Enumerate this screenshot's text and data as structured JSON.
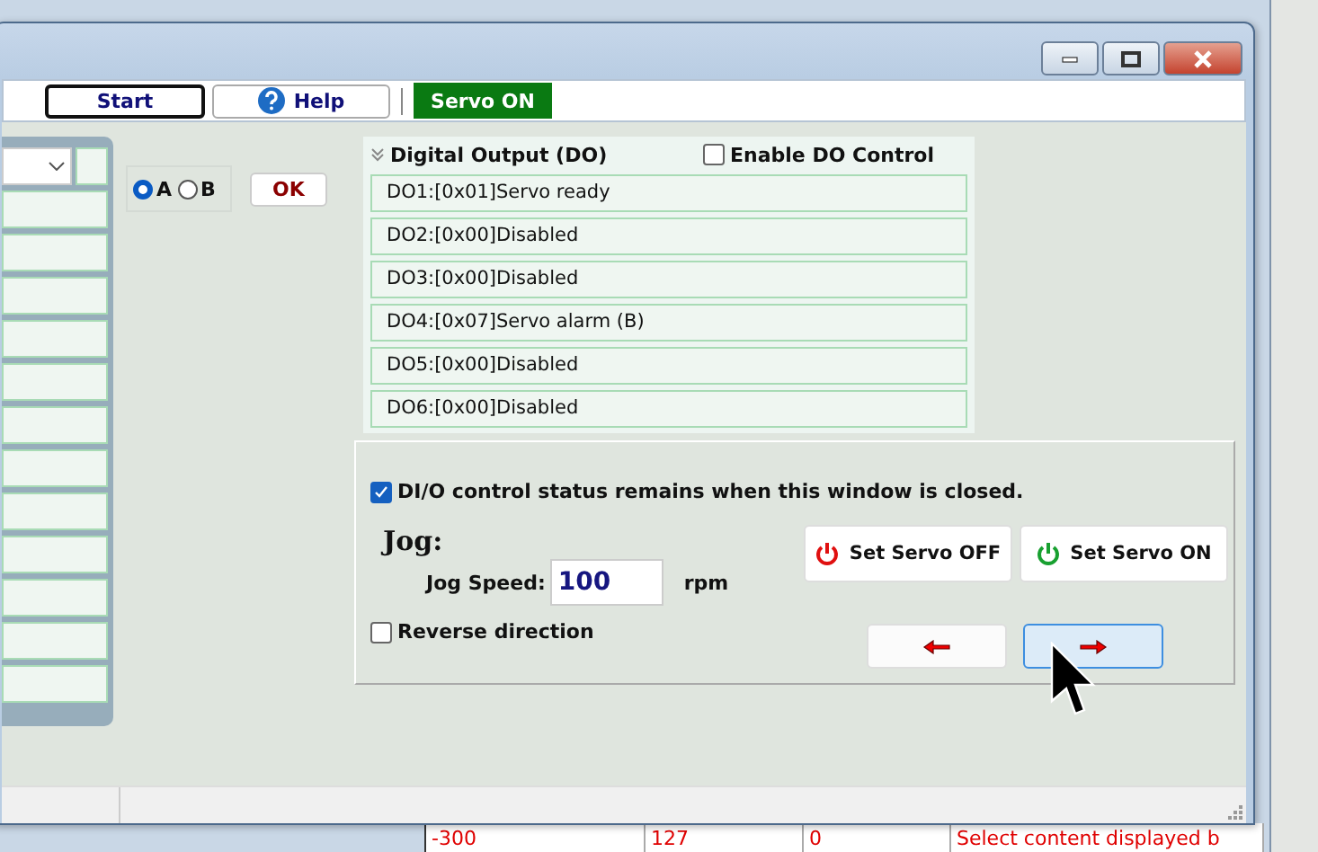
{
  "toolbar": {
    "buttons": [
      {
        "kind": "start",
        "label": "Start"
      },
      {
        "kind": "help",
        "label": "Help"
      }
    ],
    "status_badge": "Servo ON"
  },
  "channel_select": {
    "options": [
      {
        "label": "A",
        "selected": true
      },
      {
        "label": "B",
        "selected": false
      }
    ],
    "ok_button": "OK"
  },
  "digital_output": {
    "title": "Digital Output (DO)",
    "enable_control": {
      "label": "Enable DO Control",
      "checked": false
    },
    "rows": [
      "DO1:[0x01]Servo ready",
      "DO2:[0x00]Disabled",
      "DO3:[0x00]Disabled",
      "DO4:[0x07]Servo alarm (B)",
      "DO5:[0x00]Disabled",
      "DO6:[0x00]Disabled"
    ]
  },
  "keep_status": {
    "label": "DI/O control status remains when this window is closed.",
    "checked": true
  },
  "jog": {
    "title": "Jog:",
    "speed_label": "Jog Speed:",
    "speed_value": "100",
    "unit": "rpm",
    "reverse": {
      "label": "Reverse direction",
      "checked": false
    },
    "direction_buttons": [
      {
        "kind": "left",
        "hovered": false
      },
      {
        "kind": "right",
        "hovered": true
      }
    ]
  },
  "servo_buttons": [
    {
      "kind": "off",
      "label": "Set Servo OFF"
    },
    {
      "kind": "on",
      "label": "Set Servo ON"
    }
  ],
  "back_window": {
    "table_row": [
      "-300",
      "127",
      "0",
      "Select content displayed b"
    ]
  }
}
